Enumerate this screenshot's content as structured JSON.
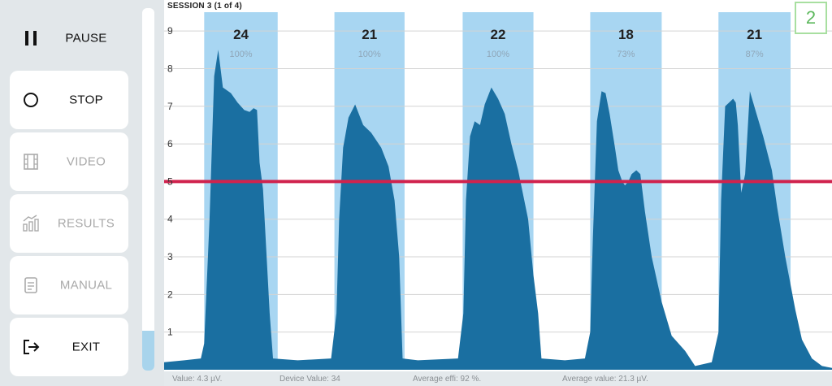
{
  "sidebar": {
    "pause_label": "PAUSE",
    "stop_label": "STOP",
    "video_label": "VIDEO",
    "results_label": "RESULTS",
    "manual_label": "MANUAL",
    "exit_label": "EXIT",
    "scroll_level_fraction": 0.11
  },
  "header": {
    "session_title": "SESSION 3 (1 of 4)",
    "page_badge": "2"
  },
  "footer": {
    "value": "Value: 4.3 µV.",
    "device_value": "Device Value: 34",
    "average_effi": "Average effi: 92 %.",
    "average_value": "Average value: 21.3 µV."
  },
  "colors": {
    "band": "#a8d6f2",
    "area": "#1a6fa1",
    "threshold": "#d0234e",
    "badge": "#5cb85c"
  },
  "chart_data": {
    "type": "area",
    "ylim": [
      0,
      9.5
    ],
    "yticks": [
      "1",
      "2",
      "3",
      "4",
      "5",
      "6",
      "7",
      "8",
      "9"
    ],
    "threshold": 5,
    "threshold_label": "5",
    "bands": [
      {
        "start": 0.06,
        "end": 0.17,
        "count": "24",
        "percent": "100%"
      },
      {
        "start": 0.255,
        "end": 0.36,
        "count": "21",
        "percent": "100%"
      },
      {
        "start": 0.447,
        "end": 0.553,
        "count": "22",
        "percent": "100%"
      },
      {
        "start": 0.638,
        "end": 0.745,
        "count": "18",
        "percent": "73%"
      },
      {
        "start": 0.83,
        "end": 0.938,
        "count": "21",
        "percent": "87%"
      }
    ],
    "signal": [
      [
        0,
        0.2
      ],
      [
        0.03,
        0.25
      ],
      [
        0.055,
        0.3
      ],
      [
        0.06,
        0.7
      ],
      [
        0.068,
        4.0
      ],
      [
        0.075,
        7.8
      ],
      [
        0.081,
        8.5
      ],
      [
        0.088,
        7.5
      ],
      [
        0.1,
        7.35
      ],
      [
        0.11,
        7.1
      ],
      [
        0.12,
        6.9
      ],
      [
        0.128,
        6.85
      ],
      [
        0.134,
        6.95
      ],
      [
        0.139,
        6.9
      ],
      [
        0.143,
        5.5
      ],
      [
        0.148,
        4.8
      ],
      [
        0.158,
        1.5
      ],
      [
        0.163,
        0.3
      ],
      [
        0.2,
        0.25
      ],
      [
        0.25,
        0.3
      ],
      [
        0.258,
        1.5
      ],
      [
        0.262,
        4.0
      ],
      [
        0.268,
        5.9
      ],
      [
        0.276,
        6.7
      ],
      [
        0.286,
        7.05
      ],
      [
        0.298,
        6.5
      ],
      [
        0.31,
        6.3
      ],
      [
        0.325,
        5.9
      ],
      [
        0.336,
        5.4
      ],
      [
        0.345,
        4.5
      ],
      [
        0.352,
        3.0
      ],
      [
        0.357,
        0.3
      ],
      [
        0.38,
        0.25
      ],
      [
        0.44,
        0.3
      ],
      [
        0.448,
        1.5
      ],
      [
        0.452,
        4.5
      ],
      [
        0.458,
        6.2
      ],
      [
        0.465,
        6.6
      ],
      [
        0.473,
        6.5
      ],
      [
        0.48,
        7.05
      ],
      [
        0.49,
        7.5
      ],
      [
        0.5,
        7.2
      ],
      [
        0.51,
        6.8
      ],
      [
        0.52,
        6.0
      ],
      [
        0.53,
        5.3
      ],
      [
        0.545,
        4.0
      ],
      [
        0.553,
        2.5
      ],
      [
        0.56,
        1.5
      ],
      [
        0.565,
        0.3
      ],
      [
        0.6,
        0.25
      ],
      [
        0.63,
        0.3
      ],
      [
        0.638,
        1.0
      ],
      [
        0.642,
        3.5
      ],
      [
        0.648,
        6.6
      ],
      [
        0.655,
        7.4
      ],
      [
        0.661,
        7.35
      ],
      [
        0.667,
        6.8
      ],
      [
        0.675,
        5.9
      ],
      [
        0.68,
        5.3
      ],
      [
        0.686,
        5.0
      ],
      [
        0.69,
        4.9
      ],
      [
        0.695,
        5.0
      ],
      [
        0.7,
        5.2
      ],
      [
        0.707,
        5.3
      ],
      [
        0.713,
        5.2
      ],
      [
        0.72,
        4.2
      ],
      [
        0.73,
        3.0
      ],
      [
        0.745,
        1.8
      ],
      [
        0.76,
        0.9
      ],
      [
        0.78,
        0.5
      ],
      [
        0.795,
        0.1
      ],
      [
        0.82,
        0.2
      ],
      [
        0.83,
        1.0
      ],
      [
        0.834,
        4.5
      ],
      [
        0.84,
        7.0
      ],
      [
        0.852,
        7.2
      ],
      [
        0.856,
        7.1
      ],
      [
        0.859,
        6.5
      ],
      [
        0.864,
        4.7
      ],
      [
        0.87,
        5.2
      ],
      [
        0.877,
        7.4
      ],
      [
        0.887,
        6.8
      ],
      [
        0.897,
        6.2
      ],
      [
        0.91,
        5.3
      ],
      [
        0.918,
        4.3
      ],
      [
        0.93,
        3.0
      ],
      [
        0.945,
        1.6
      ],
      [
        0.955,
        0.8
      ],
      [
        0.97,
        0.3
      ],
      [
        0.985,
        0.1
      ],
      [
        1.0,
        0.05
      ]
    ]
  }
}
